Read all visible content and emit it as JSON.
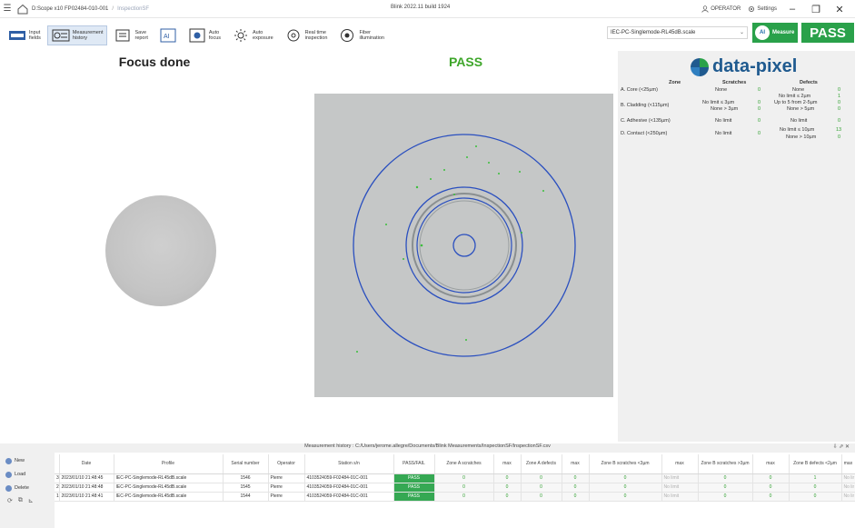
{
  "titlebar": {
    "path": "D:Scope x10 FP02484-010-001",
    "leaf": "InspectionSF",
    "build": "Blink 2022.11 build 1924",
    "operator": "OPERATOR",
    "settings": "Settings"
  },
  "toolbar": {
    "tools": [
      {
        "label": "Input\nfields"
      },
      {
        "label": "Measurement\nhistory"
      },
      {
        "label": "Save\nreport"
      },
      {
        "label": "Auto\nfocus"
      },
      {
        "label": "Auto\nexposure"
      },
      {
        "label": "Real time\ninspection"
      },
      {
        "label": "Fiber\nillumination"
      }
    ],
    "profile": "IEC-PC-Singlemode-RL45dB.scale",
    "measure": "Measure",
    "result": "PASS"
  },
  "main": {
    "focus_title": "Focus done",
    "result_title": "PASS"
  },
  "panel": {
    "logo": "data-pixel",
    "headers": {
      "zone": "Zone",
      "scratches": "Scratches",
      "defects": "Defects"
    },
    "zones": [
      {
        "name": "A. Core (<25µm)",
        "s1": "None",
        "s1v": "0",
        "d1": "None",
        "d1v": "0"
      },
      {
        "name": "B. Cladding (<115µm)",
        "s1": "No limit ≤ 3µm",
        "s1v": "0",
        "s2": "None > 3µm",
        "s2v": "0",
        "d1": "No limit ≤ 2µm",
        "d1v": "1",
        "d2": "Up to 5 from 2-5µm",
        "d2v": "0",
        "d3": "None > 5µm",
        "d3v": "0"
      },
      {
        "name": "C. Adhesive (<135µm)",
        "s1": "No limit",
        "s1v": "0",
        "d1": "No limit",
        "d1v": "0"
      },
      {
        "name": "D. Contact (<250µm)",
        "s1": "No limit",
        "s1v": "0",
        "d1": "No limit ≤ 10µm",
        "d1v": "13",
        "d2": "None > 10µm",
        "d2v": "0"
      }
    ]
  },
  "history": {
    "title": "Measurement history : C:/Users/jerome.allegre/Documents/Blink Measurements/InspectionSF/InspectionSF.csv",
    "buttons": {
      "new": "New",
      "load": "Load",
      "delete": "Delete"
    },
    "columns": [
      "",
      "Date",
      "Profile",
      "Serial number",
      "Operator",
      "Station s/n",
      "PASS/FAIL",
      "Zone A scratches",
      "max",
      "Zone A defects",
      "max",
      "Zone B scratches <3µm",
      "max",
      "Zone B scratches >3µm",
      "max",
      "Zone B defects <2µm",
      "max"
    ],
    "rows": [
      {
        "n": "3",
        "date": "2023/01/10 21:48:45",
        "profile": "IEC-PC-Singlemode-RL45dB.scale",
        "serial": "1546",
        "op": "Pierre",
        "station": "4103524059-F02484-01C-001",
        "result": "PASS",
        "za_s": "0",
        "za_smax": "0",
        "za_d": "0",
        "za_dmax": "0",
        "zb_s3": "0",
        "zb_s3max": "No limit",
        "zb_sg": "0",
        "zb_sgmax": "0",
        "zb_d2": "1",
        "zb_d2max": "No lir"
      },
      {
        "n": "2",
        "date": "2023/01/10 21:48:48",
        "profile": "IEC-PC-Singlemode-RL45dB.scale",
        "serial": "1545",
        "op": "Pierre",
        "station": "4103524059-F02484-01C-001",
        "result": "PASS",
        "za_s": "0",
        "za_smax": "0",
        "za_d": "0",
        "za_dmax": "0",
        "zb_s3": "0",
        "zb_s3max": "No limit",
        "zb_sg": "0",
        "zb_sgmax": "0",
        "zb_d2": "0",
        "zb_d2max": "No lir"
      },
      {
        "n": "1",
        "date": "2023/01/10 21:48:41",
        "profile": "IEC-PC-Singlemode-RL45dB.scale",
        "serial": "1544",
        "op": "Pierre",
        "station": "4103524059-F02484-01C-001",
        "result": "PASS",
        "za_s": "0",
        "za_smax": "0",
        "za_d": "0",
        "za_dmax": "0",
        "zb_s3": "0",
        "zb_s3max": "No limit",
        "zb_sg": "0",
        "zb_sgmax": "0",
        "zb_d2": "0",
        "zb_d2max": "No lir"
      }
    ]
  },
  "colors": {
    "accent_green": "#2aa14a",
    "ring_blue": "#2a4fbf",
    "brand_blue": "#1f5a8f"
  }
}
